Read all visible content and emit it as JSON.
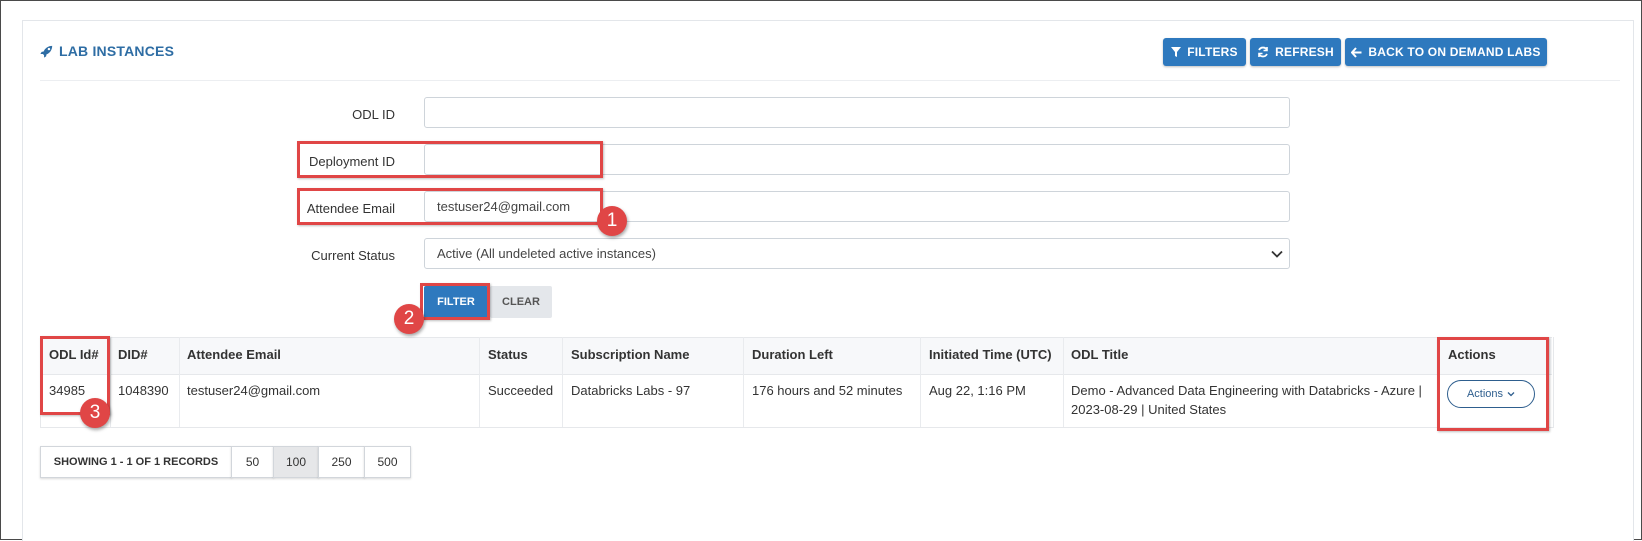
{
  "header": {
    "title": "LAB INSTANCES",
    "title_icon": "rocket-icon",
    "buttons": {
      "filters": "FILTERS",
      "refresh": "REFRESH",
      "back": "BACK TO ON DEMAND LABS"
    }
  },
  "form": {
    "odl_id_label": "ODL ID",
    "odl_id_value": "",
    "deployment_id_label": "Deployment ID",
    "deployment_id_value": "",
    "attendee_email_label": "Attendee Email",
    "attendee_email_value": "testuser24@gmail.com",
    "status_label": "Current Status",
    "status_value": "Active (All undeleted active instances)",
    "filter_button": "FILTER",
    "clear_button": "CLEAR"
  },
  "annotations": {
    "badge_1": "1",
    "badge_2": "2",
    "badge_3": "3",
    "highlight_color": "#e04646"
  },
  "table": {
    "columns": [
      "ODL Id#",
      "DID#",
      "Attendee Email",
      "Status",
      "Subscription Name",
      "Duration Left",
      "Initiated Time (UTC)",
      "ODL Title",
      "Actions"
    ],
    "rows": [
      {
        "odl_id": "34985",
        "did": "1048390",
        "email": "testuser24@gmail.com",
        "status": "Succeeded",
        "subscription": "Databricks Labs - 97",
        "duration": "176 hours and 52 minutes",
        "initiated": "Aug 22, 1:16 PM",
        "title_line1": "Demo - Advanced Data Engineering with Databricks - Azure |",
        "title_line2": "2023-08-29 | United States",
        "actions_label": "Actions"
      }
    ]
  },
  "pagination": {
    "summary": "SHOWING 1 - 1 OF 1 RECORDS",
    "sizes": [
      "50",
      "100",
      "250",
      "500"
    ],
    "selected": "100"
  },
  "colors": {
    "accent": "#2e79be",
    "title": "#2e6da4"
  }
}
